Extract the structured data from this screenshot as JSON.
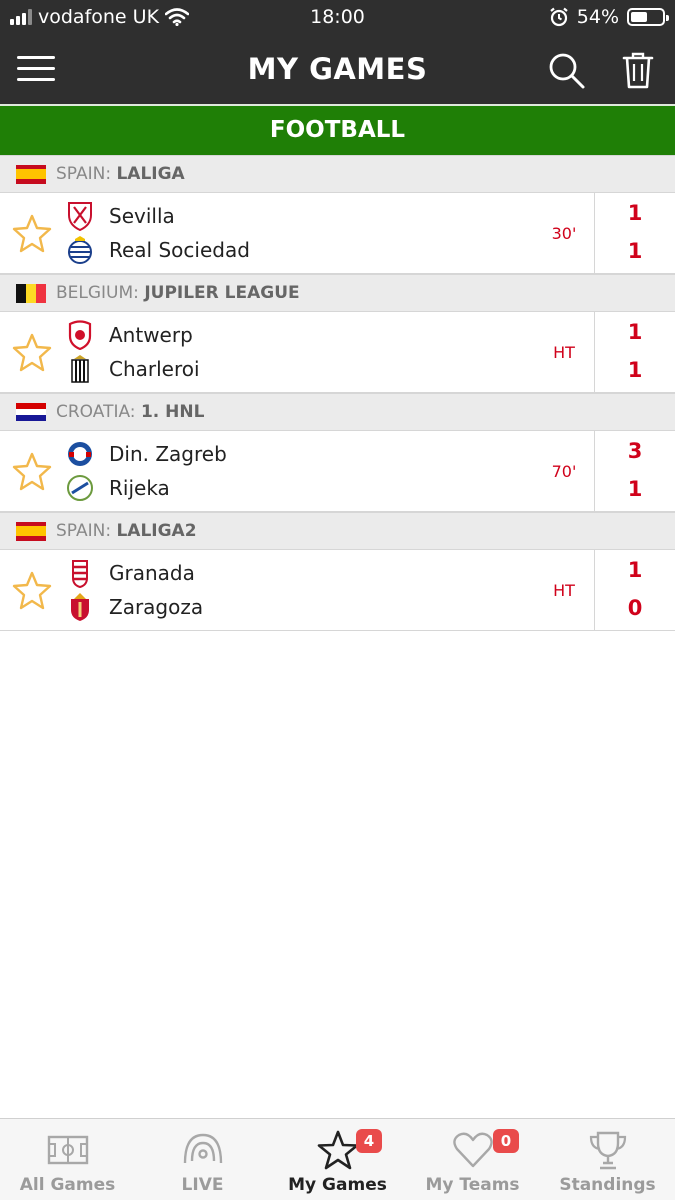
{
  "status_bar": {
    "carrier": "vodafone UK",
    "time": "18:00",
    "battery_percent": "54%",
    "battery_level": 0.54,
    "icons": [
      "signal-icon",
      "wifi-icon",
      "alarm-icon",
      "battery-icon"
    ]
  },
  "header": {
    "title": "MY GAMES",
    "icons": [
      "menu-icon",
      "search-icon",
      "trash-icon"
    ]
  },
  "sport": {
    "label": "FOOTBALL"
  },
  "leagues": [
    {
      "country": "SPAIN:",
      "competition": "LALIGA",
      "flag": "spain-flag",
      "match": {
        "home": "Sevilla",
        "away": "Real Sociedad",
        "status": "30'",
        "home_score": "1",
        "away_score": "1"
      }
    },
    {
      "country": "BELGIUM:",
      "competition": "JUPILER LEAGUE",
      "flag": "belgium-flag",
      "match": {
        "home": "Antwerp",
        "away": "Charleroi",
        "status": "HT",
        "home_score": "1",
        "away_score": "1"
      }
    },
    {
      "country": "CROATIA:",
      "competition": "1. HNL",
      "flag": "croatia-flag",
      "match": {
        "home": "Din. Zagreb",
        "away": "Rijeka",
        "status": "70'",
        "home_score": "3",
        "away_score": "1"
      }
    },
    {
      "country": "SPAIN:",
      "competition": "LALIGA2",
      "flag": "spain-flag",
      "match": {
        "home": "Granada",
        "away": "Zaragoza",
        "status": "HT",
        "home_score": "1",
        "away_score": "0"
      }
    }
  ],
  "tabs": [
    {
      "label": "All Games",
      "icon": "pitch-icon",
      "active": false
    },
    {
      "label": "LIVE",
      "icon": "live-broadcast-icon",
      "active": false
    },
    {
      "label": "My Games",
      "icon": "star-icon",
      "active": true,
      "badge": "4"
    },
    {
      "label": "My Teams",
      "icon": "heart-icon",
      "active": false,
      "badge": "0"
    },
    {
      "label": "Standings",
      "icon": "trophy-icon",
      "active": false
    }
  ],
  "colors": {
    "header_bg": "#2f2f2f",
    "sport_bar": "#1f7f06",
    "score_red": "#d0021b",
    "favorite_star": "#f2b84b",
    "badge_red": "#e94b4b"
  }
}
